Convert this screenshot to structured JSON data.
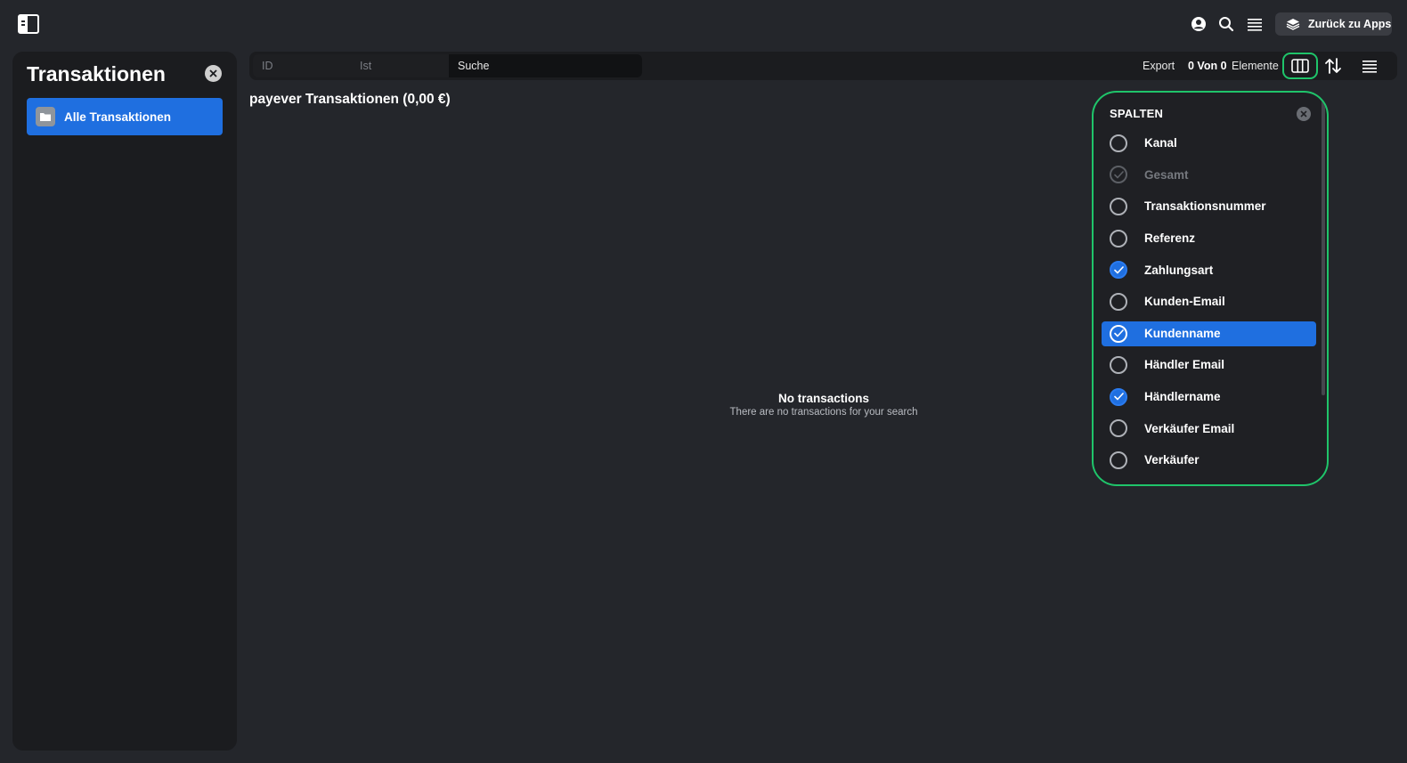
{
  "topbar": {
    "back_label": "Zurück zu Apps",
    "icons": [
      "sidebar-toggle-icon",
      "account-icon",
      "search-icon",
      "menu-icon",
      "layers-icon"
    ]
  },
  "sidebar": {
    "title": "Transaktionen",
    "items": [
      {
        "label": "Alle Transaktionen",
        "icon": "folder-icon",
        "active": true
      }
    ]
  },
  "toolbar": {
    "filter_field": "ID",
    "filter_operator": "Ist",
    "search_placeholder": "Suche",
    "export_label": "Export",
    "count_text": "0 Von 0",
    "count_suffix": "Elemente"
  },
  "main": {
    "title": "payever Transaktionen (0,00 €)",
    "empty_title": "No transactions",
    "empty_subtitle": "There are no transactions for your search"
  },
  "columns_panel": {
    "header": "SPALTEN",
    "items": [
      {
        "label": "Kanal",
        "checked": false,
        "disabled": false,
        "active": false
      },
      {
        "label": "Gesamt",
        "checked": true,
        "disabled": true,
        "active": false
      },
      {
        "label": "Transaktionsnummer",
        "checked": false,
        "disabled": false,
        "active": false
      },
      {
        "label": "Referenz",
        "checked": false,
        "disabled": false,
        "active": false
      },
      {
        "label": "Zahlungsart",
        "checked": true,
        "disabled": false,
        "active": false
      },
      {
        "label": "Kunden-Email",
        "checked": false,
        "disabled": false,
        "active": false
      },
      {
        "label": "Kundenname",
        "checked": true,
        "disabled": false,
        "active": true
      },
      {
        "label": "Händler Email",
        "checked": false,
        "disabled": false,
        "active": false
      },
      {
        "label": "Händlername",
        "checked": true,
        "disabled": false,
        "active": false
      },
      {
        "label": "Verkäufer Email",
        "checked": false,
        "disabled": false,
        "active": false
      },
      {
        "label": "Verkäufer",
        "checked": false,
        "disabled": false,
        "active": false
      }
    ]
  },
  "colors": {
    "background": "#24262b",
    "panel": "#1b1c1f",
    "accent": "#1f6fe0",
    "highlight_outline": "#1fc46a"
  }
}
